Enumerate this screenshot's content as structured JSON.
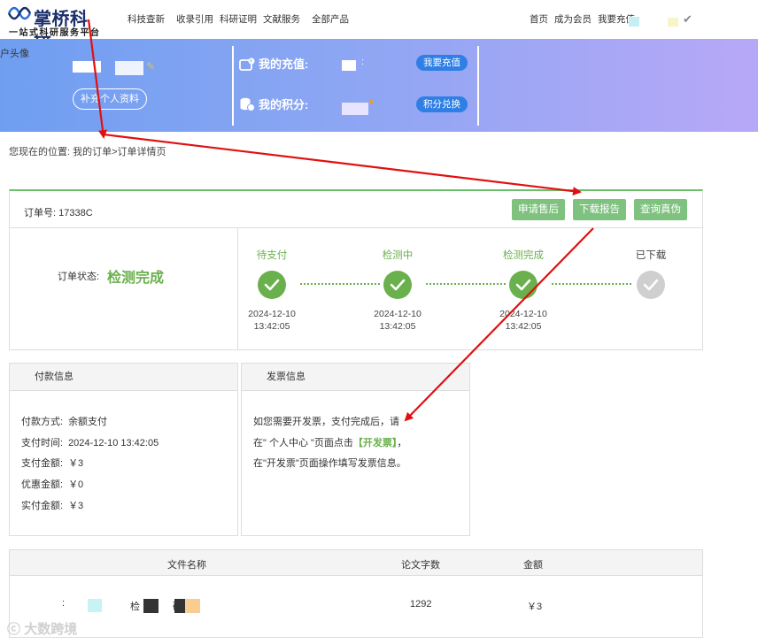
{
  "nav": {
    "logo_title": "掌桥科研",
    "logo_subtitle": "一站式科研服务平台",
    "items": [
      "科技查新",
      "收录引用",
      "科研证明",
      "文献服务",
      "全部产品"
    ],
    "right_items": [
      "首页",
      "成为会员",
      "我要充值"
    ]
  },
  "banner": {
    "avatar_label": "户头像",
    "profile_button": "补充个人资料",
    "recharge_label": "我的充值:",
    "recharge_button": "我要充值",
    "points_label": "我的积分:",
    "points_button": "积分兑换"
  },
  "breadcrumb": "您现在的位置:  我的订单>订单详情页",
  "order": {
    "number_label": "订单号:",
    "number_value": "17338C",
    "buttons": [
      "申请售后",
      "下载报告",
      "查询真伪"
    ],
    "status_label": "订单状态:",
    "status_value": "检测完成",
    "steps": [
      {
        "title": "待支付",
        "date": "2024-12-10",
        "time": "13:42:05",
        "done": true
      },
      {
        "title": "检测中",
        "date": "2024-12-10",
        "time": "13:42:05",
        "done": true
      },
      {
        "title": "检测完成",
        "date": "2024-12-10",
        "time": "13:42:05",
        "done": true
      },
      {
        "title": "已下载",
        "date": "",
        "time": "",
        "done": false
      }
    ]
  },
  "payment": {
    "heading": "付款信息",
    "rows": [
      {
        "label": "付款方式:",
        "value": "余额支付"
      },
      {
        "label": "支付时间:",
        "value": "2024-12-10 13:42:05"
      },
      {
        "label": "支付金额:",
        "value": "￥3"
      },
      {
        "label": "优惠金额:",
        "value": "￥0"
      },
      {
        "label": "实付金额:",
        "value": "￥3"
      }
    ]
  },
  "invoice": {
    "heading": "发票信息",
    "line1": "如您需要开发票，支付完成后，请",
    "line2_a": "在\" 个人中心 \"页面点击",
    "line2_link": "【开发票】",
    "line2_b": "，",
    "line3": "在\"开发票\"页面操作填写发票信息。"
  },
  "files": {
    "headers": [
      "文件名称",
      "论文字数",
      "金额"
    ],
    "rows": [
      {
        "name_fragment_a": "检",
        "name_fragment_b": "硕",
        "words": "1292",
        "amount": "￥3"
      }
    ]
  },
  "watermark": "大数跨境",
  "colors": {
    "accent_green": "#6ab04c",
    "button_green": "#7fc27f",
    "pill_blue": "#2f7fe4",
    "annotation_red": "#e01010"
  }
}
